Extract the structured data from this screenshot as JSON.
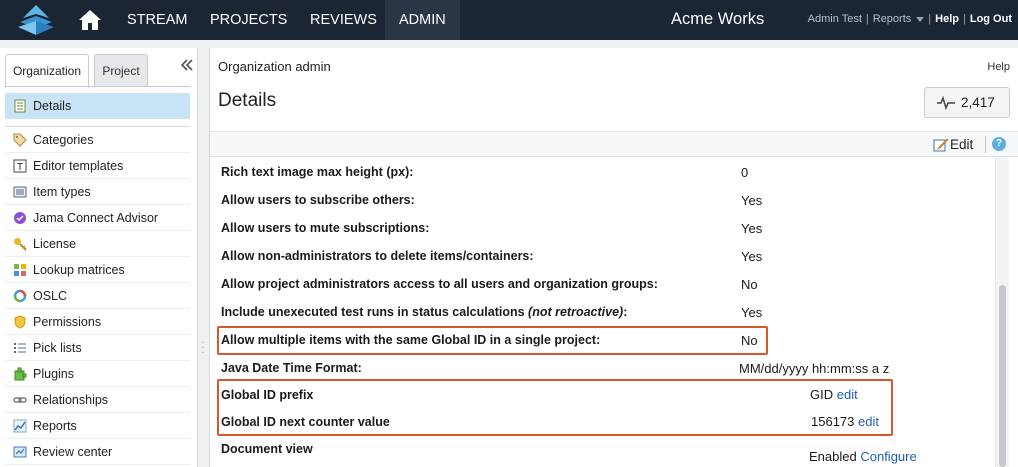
{
  "nav": {
    "items": [
      "STREAM",
      "PROJECTS",
      "REVIEWS",
      "ADMIN"
    ],
    "brand": "Acme Works",
    "user": "Admin Test",
    "reports": "Reports",
    "help": "Help",
    "logout": "Log Out"
  },
  "sidebar": {
    "tabs": [
      "Organization",
      "Project"
    ],
    "selected": "Details",
    "items": [
      {
        "label": "Categories",
        "icon": "tag-icon"
      },
      {
        "label": "Editor templates",
        "icon": "template-icon"
      },
      {
        "label": "Item types",
        "icon": "item-types-icon"
      },
      {
        "label": "Jama Connect Advisor",
        "icon": "advisor-icon"
      },
      {
        "label": "License",
        "icon": "key-icon"
      },
      {
        "label": "Lookup matrices",
        "icon": "matrix-icon"
      },
      {
        "label": "OSLC",
        "icon": "oslc-icon"
      },
      {
        "label": "Permissions",
        "icon": "shield-icon"
      },
      {
        "label": "Pick lists",
        "icon": "list-icon"
      },
      {
        "label": "Plugins",
        "icon": "plugin-icon"
      },
      {
        "label": "Relationships",
        "icon": "link-icon"
      },
      {
        "label": "Reports",
        "icon": "chart-icon"
      },
      {
        "label": "Review center",
        "icon": "review-icon"
      }
    ]
  },
  "main": {
    "breadcrumb": "Organization admin",
    "help": "Help",
    "title": "Details",
    "counter": "2,417",
    "edit": "Edit",
    "info": "?",
    "rows": [
      {
        "label": "Rich text image max height (px):",
        "value": "0"
      },
      {
        "label": "Allow users to subscribe others:",
        "value": "Yes"
      },
      {
        "label": "Allow users to mute subscriptions:",
        "value": "Yes"
      },
      {
        "label": "Allow non-administrators to delete items/containers:",
        "value": "Yes"
      },
      {
        "label": "Allow project administrators access to all users and organization groups:",
        "value": "No"
      },
      {
        "label": "Include unexecuted test runs in status calculations ",
        "note": "(not retroactive)",
        "suffix": ":",
        "value": "Yes"
      },
      {
        "label": "Allow multiple items with the same Global ID in a single project:",
        "value": "No"
      },
      {
        "label": "Java Date Time Format:",
        "value": "MM/dd/yyyy hh:mm:ss a z"
      },
      {
        "label": "Global ID prefix",
        "value": "GID",
        "link": "edit"
      },
      {
        "label": "Global ID next counter value",
        "value": "156173",
        "link": "edit"
      },
      {
        "label": "Document view",
        "value": "Enabled",
        "link": "Configure"
      }
    ]
  },
  "colors": {
    "topbar": "#1c2533",
    "highlight": "#d9582b",
    "selected": "#c8e3f5",
    "link": "#1f5fb4"
  }
}
